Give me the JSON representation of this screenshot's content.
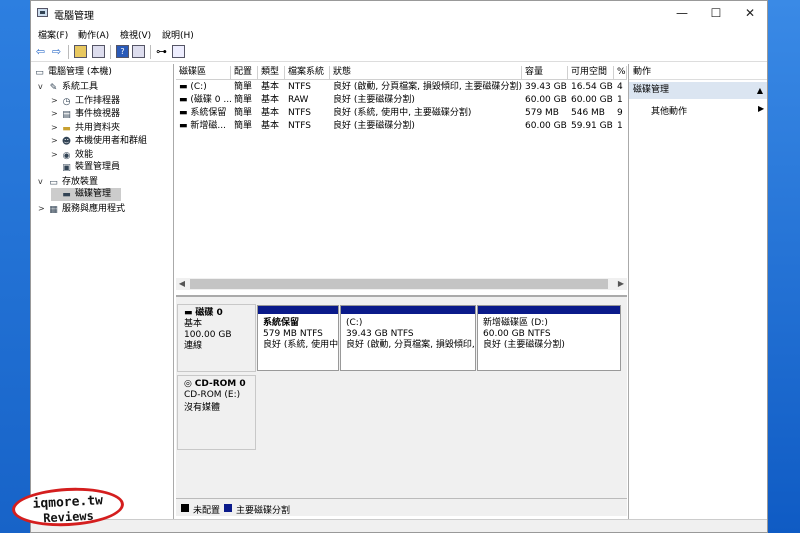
{
  "window": {
    "title": "電腦管理",
    "minimize": "—",
    "maximize": "☐",
    "close": "✕"
  },
  "menu": [
    "檔案(F)",
    "動作(A)",
    "檢視(V)",
    "說明(H)"
  ],
  "toolbar": {
    "back": "⇦",
    "forward": "⇨",
    "help": "?"
  },
  "tree": [
    {
      "label": "電腦管理 (本機)",
      "chev": ""
    },
    {
      "label": "系統工具",
      "chev": "v"
    },
    {
      "label": "工作排程器",
      "chev": ">"
    },
    {
      "label": "事件檢視器",
      "chev": ">"
    },
    {
      "label": "共用資料夾",
      "chev": ">"
    },
    {
      "label": "本機使用者和群組",
      "chev": ">"
    },
    {
      "label": "效能",
      "chev": ">"
    },
    {
      "label": "裝置管理員",
      "chev": ""
    },
    {
      "label": "存放裝置",
      "chev": "v"
    },
    {
      "label": "磁碟管理",
      "chev": ""
    },
    {
      "label": "服務與應用程式",
      "chev": ">"
    }
  ],
  "volume_table": {
    "headers": [
      "磁碟區",
      "配置",
      "類型",
      "檔案系統",
      "狀態",
      "容量",
      "可用空間",
      "%"
    ],
    "rows": [
      [
        "(C:)",
        "簡單",
        "基本",
        "NTFS",
        "良好 (啟動, 分頁檔案, 損毀傾印, 主要磁碟分割)",
        "39.43 GB",
        "16.54 GB",
        "4"
      ],
      [
        "(磁碟 0 ...",
        "簡單",
        "基本",
        "RAW",
        "良好 (主要磁碟分割)",
        "60.00 GB",
        "60.00 GB",
        "1"
      ],
      [
        "系統保留",
        "簡單",
        "基本",
        "NTFS",
        "良好 (系統, 使用中, 主要磁碟分割)",
        "579 MB",
        "546 MB",
        "9"
      ],
      [
        "新增磁...",
        "簡單",
        "基本",
        "NTFS",
        "良好 (主要磁碟分割)",
        "60.00 GB",
        "59.91 GB",
        "1"
      ]
    ]
  },
  "disks": [
    {
      "name": "磁碟 0",
      "type": "基本",
      "size": "100.00 GB",
      "status": "連線"
    },
    {
      "name": "CD-ROM 0",
      "type": "CD-ROM (E:)",
      "size": "",
      "status": "沒有媒體"
    }
  ],
  "partitions": [
    {
      "name": "系統保留",
      "size": "579 MB NTFS",
      "status": "良好 (系統, 使用中"
    },
    {
      "name": "(C:)",
      "size": "39.43 GB NTFS",
      "status": "良好 (啟動, 分頁檔案, 損毀傾印,"
    },
    {
      "name": "新增磁碟區 (D:)",
      "size": "60.00 GB NTFS",
      "status": "良好 (主要磁碟分割)"
    }
  ],
  "legend": [
    {
      "label": "未配置",
      "color": "#000000"
    },
    {
      "label": "主要磁碟分割",
      "color": "#0a1a8a"
    }
  ],
  "actions": {
    "header": "動作",
    "section": "磁碟管理",
    "more": "其他動作"
  },
  "watermark": {
    "line1": "iqmore.tw",
    "line2": "Reviews"
  }
}
